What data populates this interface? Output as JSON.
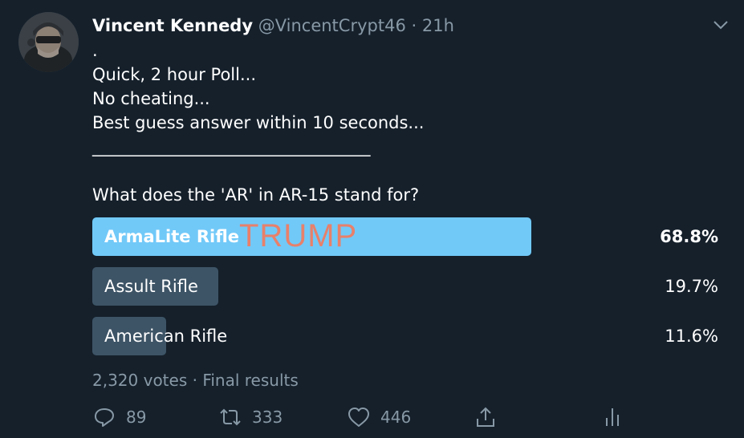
{
  "tweet": {
    "author_name": "Vincent Kennedy",
    "handle": "@VincentCrypt46",
    "separator": "·",
    "time": "21h",
    "lines": [
      ".",
      "Quick, 2 hour Poll...",
      "No cheating...",
      "Best guess answer within 10 seconds...",
      "_________________________________"
    ],
    "question": "What does the 'AR' in AR-15 stand for?"
  },
  "poll": {
    "options": [
      {
        "label": "ArmaLite Rifle",
        "percent_text": "68.8%",
        "percent": 68.8
      },
      {
        "label": "Assult Rifle",
        "percent_text": "19.7%",
        "percent": 19.7
      },
      {
        "label": "American Rifle",
        "percent_text": "11.6%",
        "percent": 11.6
      }
    ],
    "overlay_text": "TRUMP",
    "votes_summary": "2,320 votes · Final results"
  },
  "actions": {
    "reply_count": "89",
    "retweet_count": "333",
    "like_count": "446"
  },
  "colors": {
    "background": "#15202b",
    "winner_bar": "#71c9f8",
    "other_bar": "#3d5466",
    "muted_text": "#8899a6",
    "overlay_text": "#e8806a"
  }
}
